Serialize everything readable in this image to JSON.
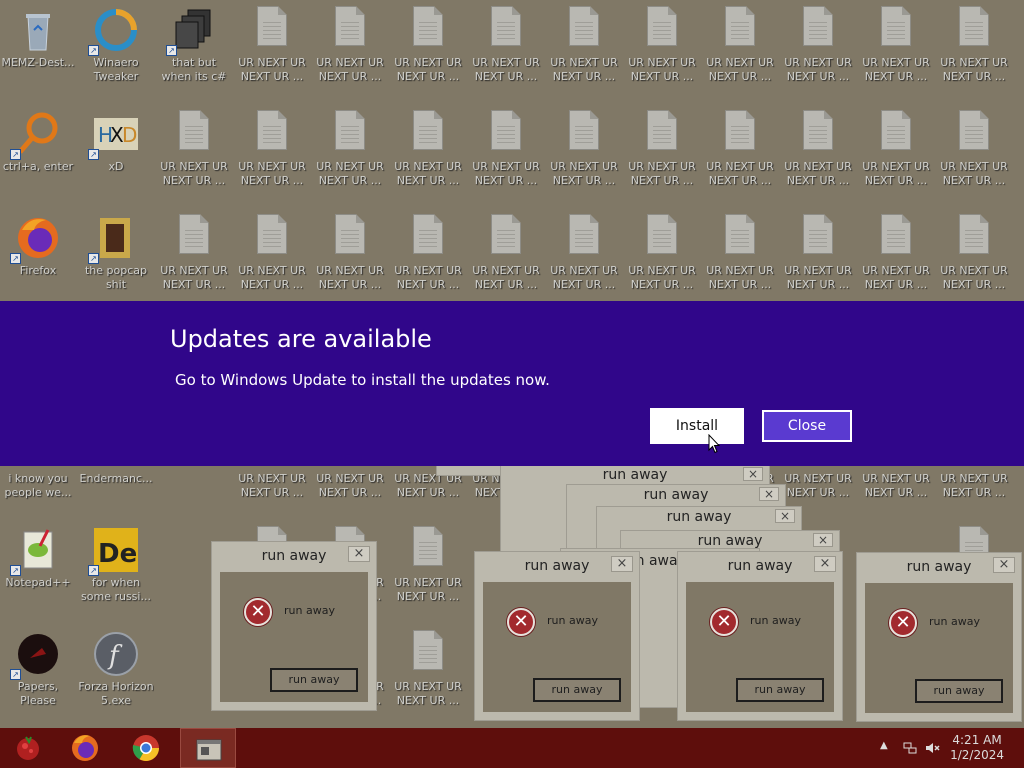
{
  "desktop": {
    "app_icons": [
      {
        "name": "memz-desktop-icon",
        "label": "MEMZ-Dest..."
      },
      {
        "name": "winaero-tweaker-icon",
        "label": "Winaero Tweaker"
      },
      {
        "name": "that-but-when-icon",
        "label": "that but when its c#"
      },
      {
        "name": "ctrl-a-enter-icon",
        "label": "ctrl+a, enter"
      },
      {
        "name": "xd-icon",
        "label": "xD"
      },
      {
        "name": "firefox-icon",
        "label": "Firefox"
      },
      {
        "name": "the-popcap-shit-icon",
        "label": "the popcap shit"
      },
      {
        "name": "i-know-you-icon",
        "label": "i know you people we..."
      },
      {
        "name": "endermanch-icon",
        "label": "Endermanc..."
      },
      {
        "name": "notepadpp-icon",
        "label": "Notepad++"
      },
      {
        "name": "for-when-icon",
        "label": "for when some russi..."
      },
      {
        "name": "papers-please-icon",
        "label": "Papers, Please"
      },
      {
        "name": "forza-horizon-icon",
        "label": "Forza Horizon 5.exe"
      }
    ],
    "doc_label": "UR NEXT UR NEXT UR ..."
  },
  "popups": {
    "title": "run away",
    "message": "run away",
    "button": "run away",
    "close_glyph": "×"
  },
  "update_banner": {
    "title": "Updates are available",
    "message": "Go to Windows Update to install the updates now.",
    "install_label": "Install",
    "close_label": "Close"
  },
  "taskbar": {
    "pinned": [
      "start-button",
      "firefox",
      "chrome",
      "window-thumbnail"
    ],
    "tray_time": "4:21 AM",
    "tray_date": "1/2/2024"
  },
  "colors": {
    "banner": "#30068a",
    "close_button": "#5a3ad0",
    "taskbar": "#5e0e0c"
  }
}
